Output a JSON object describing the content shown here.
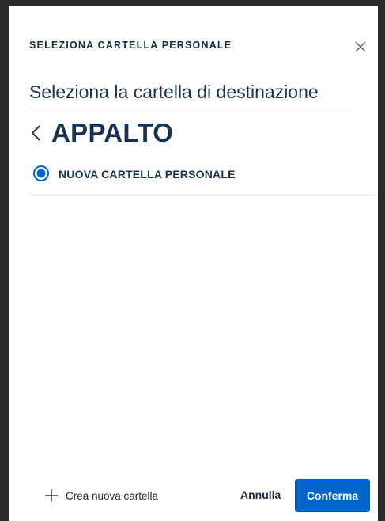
{
  "modal": {
    "title": "SELEZIONA CARTELLA PERSONALE",
    "subtitle": "Seleziona la cartella di destinazione",
    "close_icon": "close-icon"
  },
  "breadcrumb": {
    "back_icon": "chevron-left-icon",
    "current_folder": "APPALTO"
  },
  "folders": [
    {
      "label": "NUOVA CARTELLA PERSONALE",
      "selected": true
    }
  ],
  "footer": {
    "new_folder_icon": "plus-icon",
    "new_folder_label": "Crea nuova cartella",
    "cancel_label": "Annulla",
    "confirm_label": "Conferma"
  },
  "colors": {
    "primary": "#0066cc",
    "text_dark": "#17324d"
  }
}
